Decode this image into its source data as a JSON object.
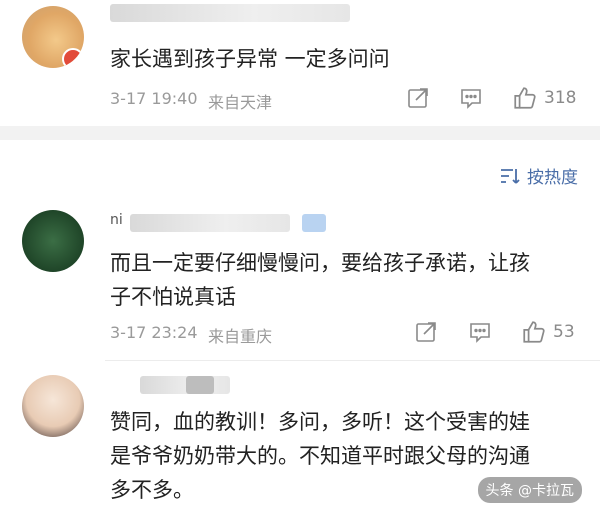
{
  "comments": [
    {
      "username": "",
      "text": "家长遇到孩子异常 一定多问问",
      "time": "3-17 19:40",
      "source": "来自天津",
      "likes": "318"
    },
    {
      "username": "ni",
      "text": "而且一定要仔细慢慢问，要给孩子承诺，让孩\n子不怕说真话",
      "time": "3-17 23:24",
      "source": "来自重庆",
      "likes": "53"
    },
    {
      "username": "",
      "text": "赞同，血的教训！多问，多听！这个受害的娃\n是爷爷奶奶带大的。不知道平时跟父母的沟通\n多不多。"
    }
  ],
  "sort_label": "按热度",
  "watermark": "头条 @卡拉瓦",
  "icons": {
    "share": "share-icon",
    "comment": "comment-icon",
    "like": "thumbs-up-icon",
    "sort": "sort-icon"
  },
  "colors": {
    "accent": "#4a6ea8",
    "meta": "#9a9a9a",
    "divider": "#f2f2f2"
  }
}
